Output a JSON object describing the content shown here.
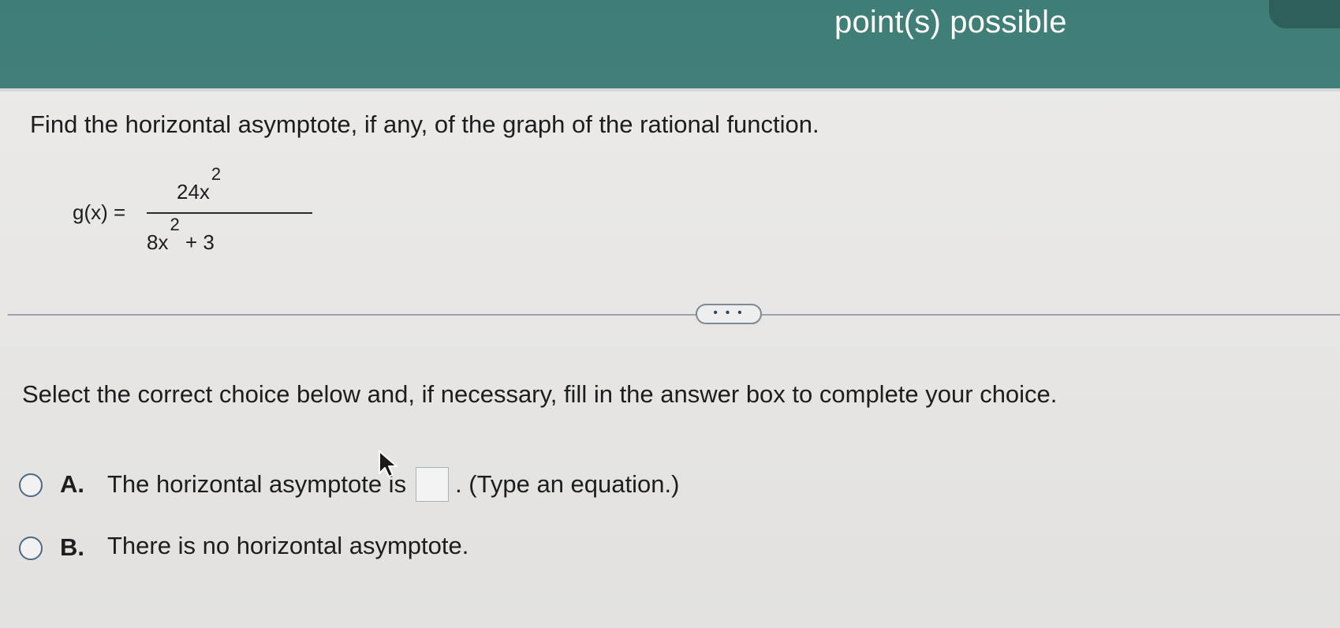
{
  "header": {
    "points_label": "point(s) possible"
  },
  "question": {
    "prompt": "Find the horizontal asymptote, if any, of the graph of the rational function.",
    "function_lhs": "g(x) =",
    "numerator_base": "24x",
    "numerator_exponent": "2",
    "denominator_base": "8x",
    "denominator_exponent": "2",
    "denominator_rest": "+ 3"
  },
  "expand_button": {
    "label": "• • •"
  },
  "instruction": "Select the correct choice below and, if necessary, fill in the answer box to complete your choice.",
  "choices": [
    {
      "letter": "A.",
      "text_before": "The horizontal asymptote is",
      "text_after": ". (Type an equation.)",
      "answer_value": ""
    },
    {
      "letter": "B.",
      "text": "There is no horizontal asymptote."
    }
  ],
  "colors": {
    "header_teal": "#427f79",
    "radio_border": "#4c6a84",
    "divider": "#9aa3ab"
  },
  "icons": {
    "cursor": "mouse-pointer-icon"
  }
}
